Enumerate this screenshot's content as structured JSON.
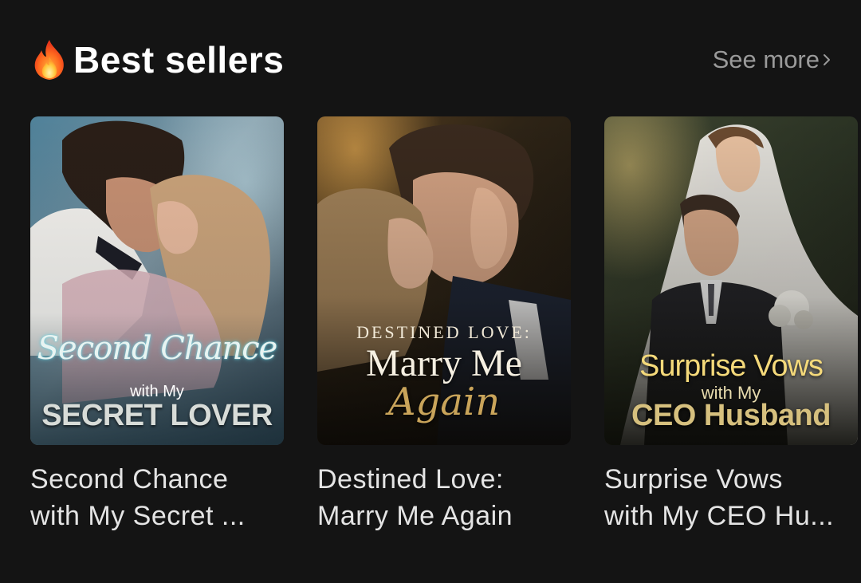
{
  "section": {
    "title": "Best sellers",
    "see_more_label": "See more",
    "icon": "fire-icon",
    "chevron_icon": "chevron-right-icon"
  },
  "books": [
    {
      "title_line1": "Second Chance",
      "title_line2": "with My Secret ...",
      "cover": {
        "script": "Second Chance",
        "with": "with My",
        "big": "SECRET LOVER"
      }
    },
    {
      "title_line1": "Destined Love:",
      "title_line2": "Marry Me Again",
      "cover": {
        "small": "DESTINED LOVE:",
        "big": "Marry Me",
        "script": "Again"
      }
    },
    {
      "title_line1": "Surprise Vows",
      "title_line2": "with My CEO Hu...",
      "cover": {
        "big": "Surprise Vows",
        "with": "with My",
        "ceo": "CEO Husband"
      }
    }
  ],
  "colors": {
    "background": "#141414",
    "title": "#ffffff",
    "see_more": "#9a9a9a",
    "book_title": "#e4e4e4"
  }
}
